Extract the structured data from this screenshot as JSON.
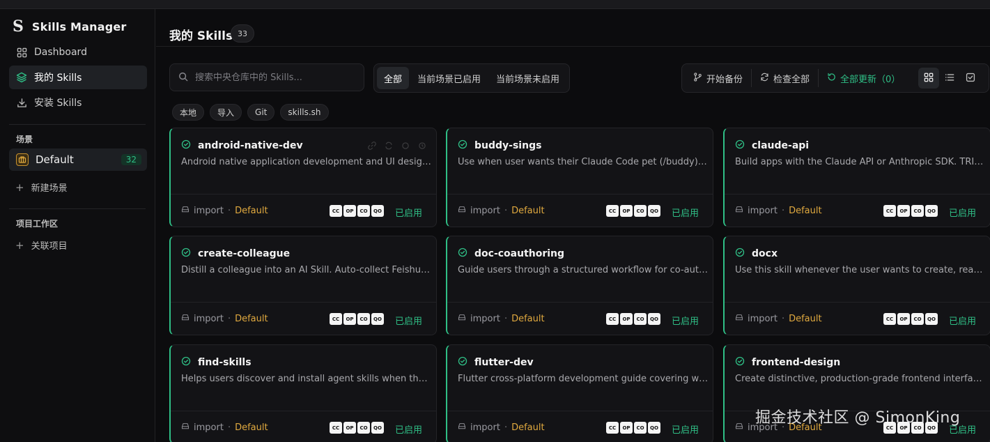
{
  "app": {
    "logo": "S",
    "name": "Skills Manager"
  },
  "sidebar": {
    "nav": [
      {
        "label": "Dashboard",
        "icon": "grid-icon"
      },
      {
        "label": "我的 Skills",
        "icon": "layers-icon",
        "active": true
      },
      {
        "label": "安装 Skills",
        "icon": "download-icon"
      }
    ],
    "scenes_label": "场景",
    "scene": {
      "name": "Default",
      "count": "32"
    },
    "new_scene": "新建场景",
    "projects_label": "项目工作区",
    "link_project": "关联项目"
  },
  "header": {
    "title": "我的 Skills",
    "count": "33"
  },
  "search": {
    "placeholder": "搜索中央仓库中的 Skills..."
  },
  "filters": [
    "全部",
    "当前场景已启用",
    "当前场景未启用"
  ],
  "actions": {
    "backup": "开始备份",
    "check_all": "检查全部",
    "update_all": "全部更新（0）"
  },
  "source_chips": [
    "本地",
    "导入",
    "Git",
    "skills.sh"
  ],
  "colors": {
    "accent": "#2fbf86",
    "scene": "#e0a93f"
  },
  "agent_badges": [
    "CC",
    "OP",
    "CO",
    "QO"
  ],
  "cards": [
    {
      "name": "android-native-dev",
      "desc": "Android native application development and UI design guidelines",
      "source": "import",
      "scene": "Default",
      "status": "已启用"
    },
    {
      "name": "buddy-sings",
      "desc": "Use when user wants their Claude Code pet (/buddy) to sing",
      "source": "import",
      "scene": "Default",
      "status": "已启用"
    },
    {
      "name": "claude-api",
      "desc": "Build apps with the Claude API or Anthropic SDK. TRIGGER when",
      "source": "import",
      "scene": "Default",
      "status": "已启用"
    },
    {
      "name": "create-colleague",
      "desc": "Distill a colleague into an AI Skill. Auto-collect Feishu/DingTalk",
      "source": "import",
      "scene": "Default",
      "status": "已启用"
    },
    {
      "name": "doc-coauthoring",
      "desc": "Guide users through a structured workflow for co-authoring",
      "source": "import",
      "scene": "Default",
      "status": "已启用"
    },
    {
      "name": "docx",
      "desc": "Use this skill whenever the user wants to create, read, edit",
      "source": "import",
      "scene": "Default",
      "status": "已启用"
    },
    {
      "name": "find-skills",
      "desc": "Helps users discover and install agent skills when they ask",
      "source": "import",
      "scene": "Default",
      "status": "已启用"
    },
    {
      "name": "flutter-dev",
      "desc": "Flutter cross-platform development guide covering widgets",
      "source": "import",
      "scene": "Default",
      "status": "已启用"
    },
    {
      "name": "frontend-design",
      "desc": "Create distinctive, production-grade frontend interfaces with",
      "source": "import",
      "scene": "Default",
      "status": "已启用"
    }
  ],
  "watermark": "掘金技术社区 @ SimonKing"
}
